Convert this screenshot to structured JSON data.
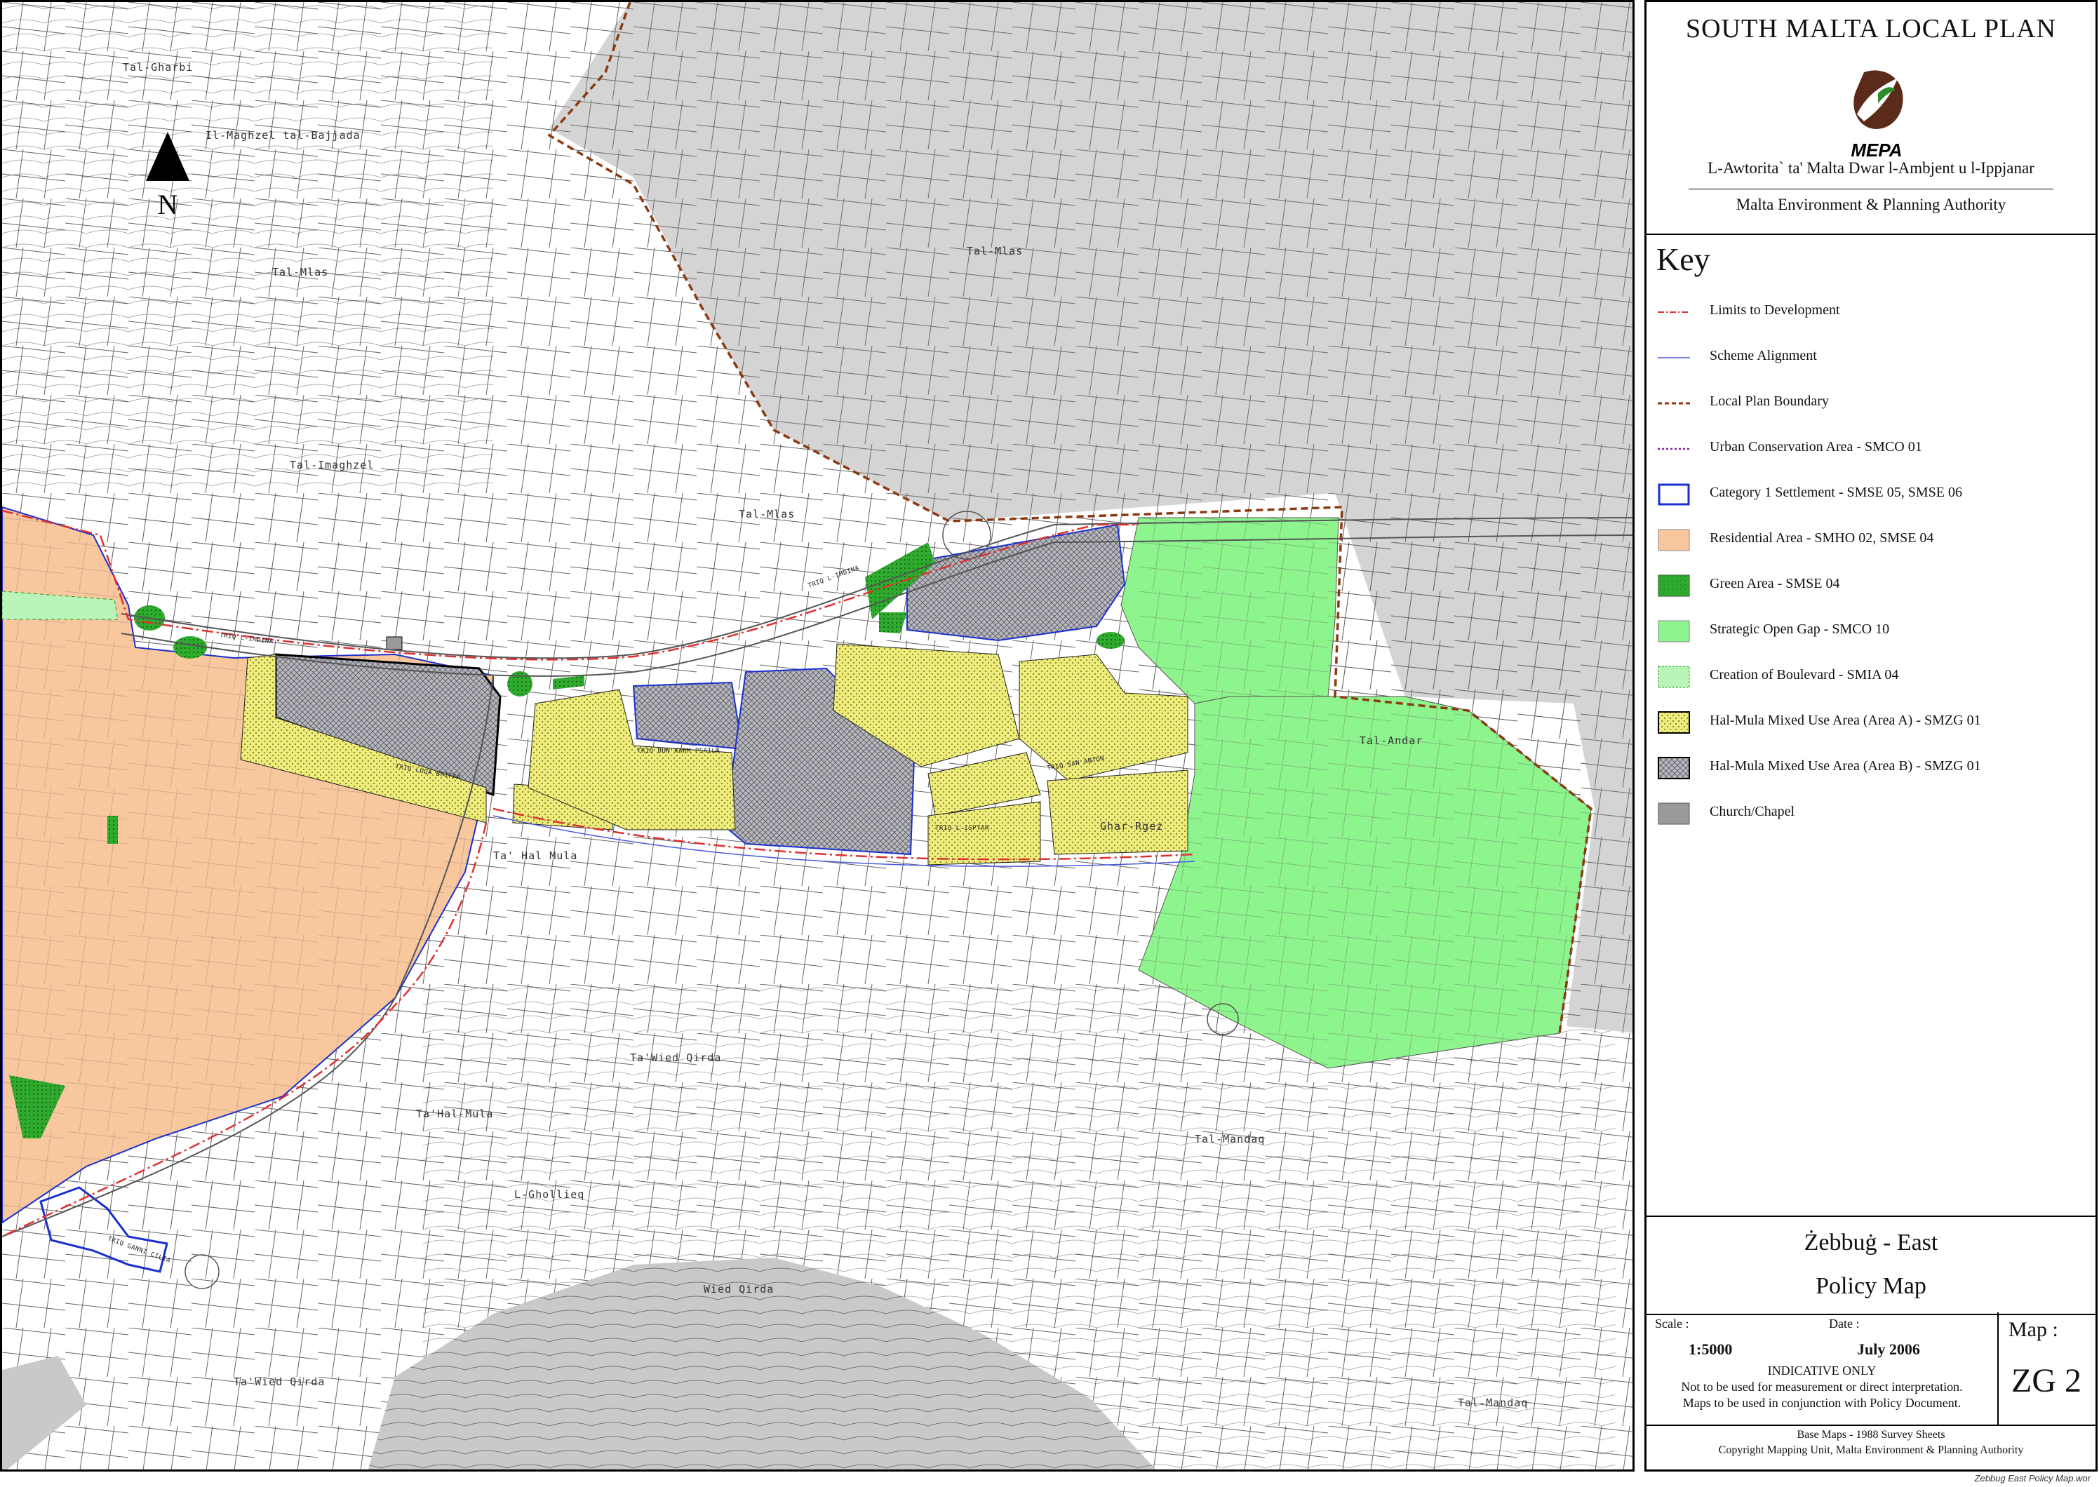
{
  "header": {
    "plan_title": "SOUTH MALTA LOCAL PLAN",
    "logo_text": "MEPA",
    "agency_maltese": "L-Awtorita` ta' Malta Dwar l-Ambjent u l-Ippjanar",
    "agency_english": "Malta Environment & Planning Authority"
  },
  "key": {
    "title": "Key",
    "items": [
      {
        "label": "Limits to Development",
        "symbol": "line-dashdot",
        "color": "#e03030"
      },
      {
        "label": "Scheme Alignment",
        "symbol": "line-solid",
        "color": "#4a5ae0"
      },
      {
        "label": "Local Plan Boundary",
        "symbol": "line-dashed",
        "color": "#8b3a12"
      },
      {
        "label": "Urban Conservation Area - SMCO 01",
        "symbol": "line-dotted",
        "color": "#8a1fb0"
      },
      {
        "label": "Category 1 Settlement - SMSE 05, SMSE 06",
        "symbol": "box-outline",
        "color": "#1a2fd0"
      },
      {
        "label": "Residential Area - SMHO 02, SMSE 04",
        "symbol": "fill",
        "color": "#f9c79e"
      },
      {
        "label": "Green Area - SMSE 04",
        "symbol": "fill-dotted",
        "color": "#1f9c1f"
      },
      {
        "label": "Strategic Open Gap - SMCO 10",
        "symbol": "fill",
        "color": "#8ef58e"
      },
      {
        "label": "Creation of Boulevard - SMIA 04",
        "symbol": "fill-dashed",
        "color": "#b9f5b9"
      },
      {
        "label": "Hal-Mula Mixed Use Area (Area A) - SMZG 01",
        "symbol": "fill-stipple",
        "color": "#eeec7a"
      },
      {
        "label": "Hal-Mula Mixed Use Area (Area B) - SMZG 01",
        "symbol": "fill-crosshatch",
        "color": "#b8b8c2"
      },
      {
        "label": "Church/Chapel",
        "symbol": "fill",
        "color": "#9a9a9a"
      }
    ]
  },
  "map_name": {
    "place": "Żebbuġ - East",
    "type": "Policy Map"
  },
  "info": {
    "scale_caption": "Scale :",
    "scale_value": "1:5000",
    "date_caption": "Date :",
    "date_value": "July 2006",
    "indicative_line1": "INDICATIVE ONLY",
    "indicative_line2": "Not to be used for measurement or direct interpretation.",
    "indicative_line3": "Maps to be used in conjunction with Policy Document.",
    "map_caption": "Map :",
    "map_code": "ZG 2"
  },
  "credits": {
    "line1": "Base Maps - 1988 Survey Sheets",
    "line2": "Copyright Mapping Unit, Malta Environment & Planning Authority"
  },
  "file_name": "Zebbug East Policy Map.wor",
  "map": {
    "north_label": "N",
    "place_names": [
      "Tal-Gharbi",
      "Il-Maghzel tal-Bajjada",
      "Tal-Mlas",
      "Tal-Imaghzel",
      "Tal-Mlas",
      "Tal-Mlas",
      "Tal-Andar",
      "Ta' Hal Mula",
      "Ta'Wied Qirda",
      "Ta'Hal-Mula",
      "Tal-Mandaq",
      "L-Ghollieq",
      "Wied Qirda",
      "Ta'Wied Qirda",
      "Tal-Mandaq",
      "Ghar-Rgez"
    ],
    "street_names": [
      "TRIQ L-IMDINA",
      "TRIQ L-IMDINA",
      "TRIQ LUQA BRIFFA",
      "TRIQ DUN KARM PSAILA",
      "TRIQ SAN ANTON",
      "TRIQ L-ISPTAR",
      "TRIQ GANNI CILIA"
    ]
  }
}
